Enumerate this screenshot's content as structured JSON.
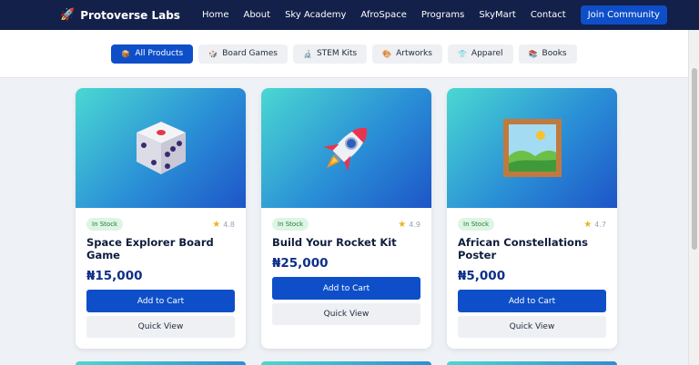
{
  "nav": {
    "brand": "Protoverse Labs",
    "links": [
      "Home",
      "About",
      "Sky Academy",
      "AfroSpace",
      "Programs",
      "SkyMart",
      "Contact"
    ],
    "join_label": "Join Community"
  },
  "filters": [
    {
      "label": "All Products",
      "icon": "📦",
      "active": true
    },
    {
      "label": "Board Games",
      "icon": "🎲",
      "active": false
    },
    {
      "label": "STEM Kits",
      "icon": "🔬",
      "active": false
    },
    {
      "label": "Artworks",
      "icon": "🎨",
      "active": false
    },
    {
      "label": "Apparel",
      "icon": "👕",
      "active": false
    },
    {
      "label": "Books",
      "icon": "📚",
      "active": false
    }
  ],
  "products": [
    {
      "stock": "In Stock",
      "rating": "4.8",
      "title": "Space Explorer Board Game",
      "price": "₦15,000",
      "cart_label": "Add to Cart",
      "view_label": "Quick View",
      "icon": "dice-icon"
    },
    {
      "stock": "In Stock",
      "rating": "4.9",
      "title": "Build Your Rocket Kit",
      "price": "₦25,000",
      "cart_label": "Add to Cart",
      "view_label": "Quick View",
      "icon": "rocket-icon"
    },
    {
      "stock": "In Stock",
      "rating": "4.7",
      "title": "African Constellations Poster",
      "price": "₦5,000",
      "cart_label": "Add to Cart",
      "view_label": "Quick View",
      "icon": "framed-picture-icon"
    }
  ],
  "colors": {
    "primary": "#0e4fc9",
    "nav_bg": "#13204a",
    "price": "#0f2f8a",
    "star": "#f2b01e"
  }
}
